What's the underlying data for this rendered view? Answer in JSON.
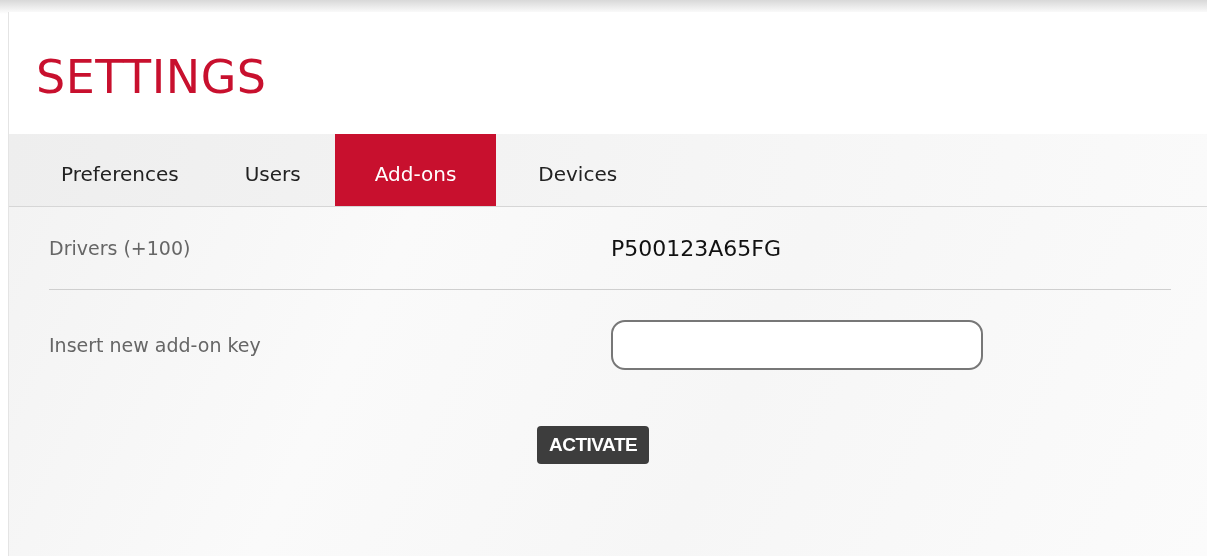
{
  "header": {
    "title": "SETTINGS"
  },
  "tabs": [
    {
      "label": "Preferences",
      "selected": false
    },
    {
      "label": "Users",
      "selected": false
    },
    {
      "label": "Add-ons",
      "selected": true
    },
    {
      "label": "Devices",
      "selected": false
    }
  ],
  "rows": [
    {
      "kind": "value",
      "label": "Drivers (+100)",
      "value": "P500123A65FG"
    },
    {
      "kind": "input",
      "label": "Insert new add-on key"
    }
  ],
  "button": {
    "label": "ACTIVATE"
  }
}
